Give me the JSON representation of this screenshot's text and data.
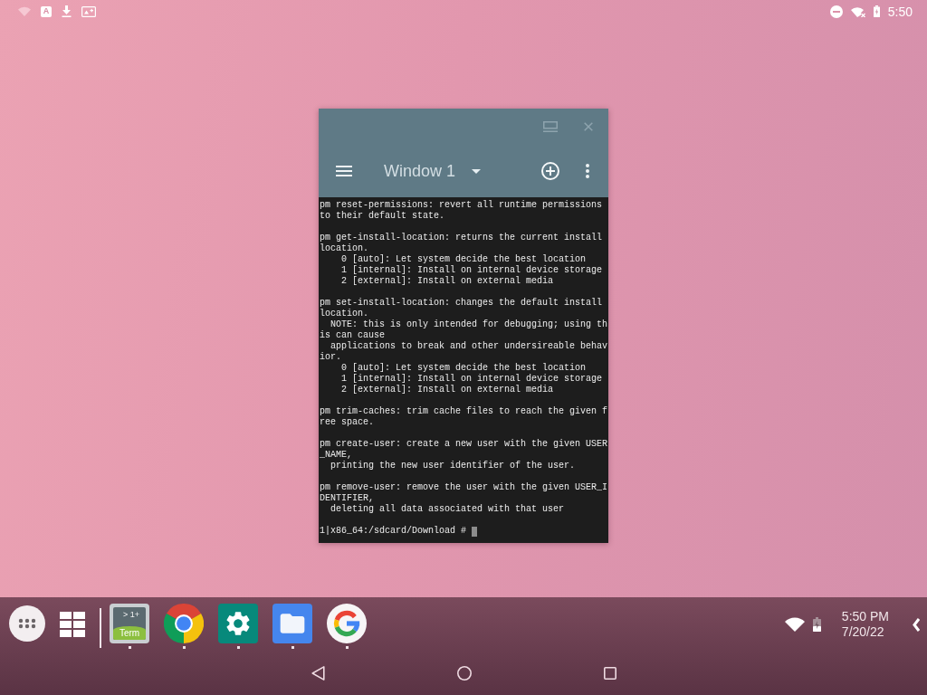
{
  "status_bar": {
    "letter_icon": "A",
    "time": "5:50"
  },
  "window": {
    "title": "Window 1",
    "terminal": {
      "blocks": [
        [
          "pm reset-permissions: revert all runtime permissions",
          "to their default state."
        ],
        [
          "pm get-install-location: returns the current install",
          "location.",
          "    0 [auto]: Let system decide the best location",
          "    1 [internal]: Install on internal device storage",
          "    2 [external]: Install on external media"
        ],
        [
          "pm set-install-location: changes the default install",
          "location.",
          "  NOTE: this is only intended for debugging; using th",
          "is can cause",
          "  applications to break and other undersireable behav",
          "ior.",
          "    0 [auto]: Let system decide the best location",
          "    1 [internal]: Install on internal device storage",
          "    2 [external]: Install on external media"
        ],
        [
          "pm trim-caches: trim cache files to reach the given f",
          "ree space."
        ],
        [
          "pm create-user: create a new user with the given USER",
          "_NAME,",
          "  printing the new user identifier of the user."
        ],
        [
          "pm remove-user: remove the user with the given USER_I",
          "DENTIFIER,",
          "  deleting all data associated with that user"
        ]
      ],
      "prompt": "1|x86_64:/sdcard/Download #"
    }
  },
  "taskbar": {
    "apps": [
      {
        "kind": "terminal",
        "icon_top": "> 1+",
        "icon_bottom": "Term",
        "running": true
      },
      {
        "kind": "chrome",
        "running": true
      },
      {
        "kind": "settings",
        "running": true
      },
      {
        "kind": "files",
        "running": true
      },
      {
        "kind": "google",
        "running": true
      }
    ],
    "time": "5:50 PM",
    "date": "7/20/22"
  }
}
